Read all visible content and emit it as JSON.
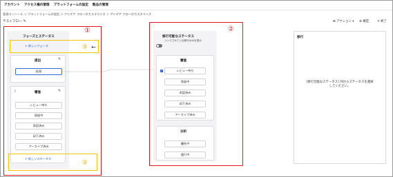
{
  "nav": {
    "items": [
      "アカウント",
      "アクセス権の管理",
      "プラットフォームの設定",
      "製品の管理"
    ]
  },
  "breadcrumb": "管理コンソール ＞ プラットフォームの設定 ＞ アイデア フローのカスタマイズ ＞ アイデア フローのカスタマイズ",
  "page_title": "テストフロー",
  "toolbar": {
    "actions": "アクション",
    "actions_chevron": "▾",
    "confirm": "確定",
    "done": "終了"
  },
  "annotations": {
    "one": "①",
    "two": "②",
    "three_top": "③",
    "three_bottom": "③",
    "arrow_glyph": "←"
  },
  "phases": {
    "title": "フェーズとステータス",
    "new_phase": "+ 新しいフェーズ",
    "new_status": "+ 新しいステータス",
    "phase1": {
      "name": "提出",
      "statuses": [
        "処理"
      ]
    },
    "phase2": {
      "name": "審査",
      "statuses": [
        "レビュー待ち",
        "保留中",
        "承認済み",
        "却下済み",
        "アーカイブ済み"
      ]
    }
  },
  "transitions": {
    "title": "移行可能なステータス",
    "toggle_label": "リンクされている移行のみを表示",
    "group1": {
      "name": "審査",
      "statuses": [
        "レビュー待ち",
        "保留中",
        "承認済み",
        "却下済み",
        "アーカイブ済み"
      ]
    },
    "group2": {
      "name": "分析",
      "statuses": [
        "優先中",
        "進行中"
      ]
    }
  },
  "right_panel": {
    "title": "移行",
    "message_line1": "[移行可能なステータス] 列からステータスを選択",
    "message_line2": "してください。"
  },
  "colors": {
    "annotation_red": "#e0131a",
    "annotation_yellow": "#f5c400",
    "link_blue": "#2b63c9"
  }
}
